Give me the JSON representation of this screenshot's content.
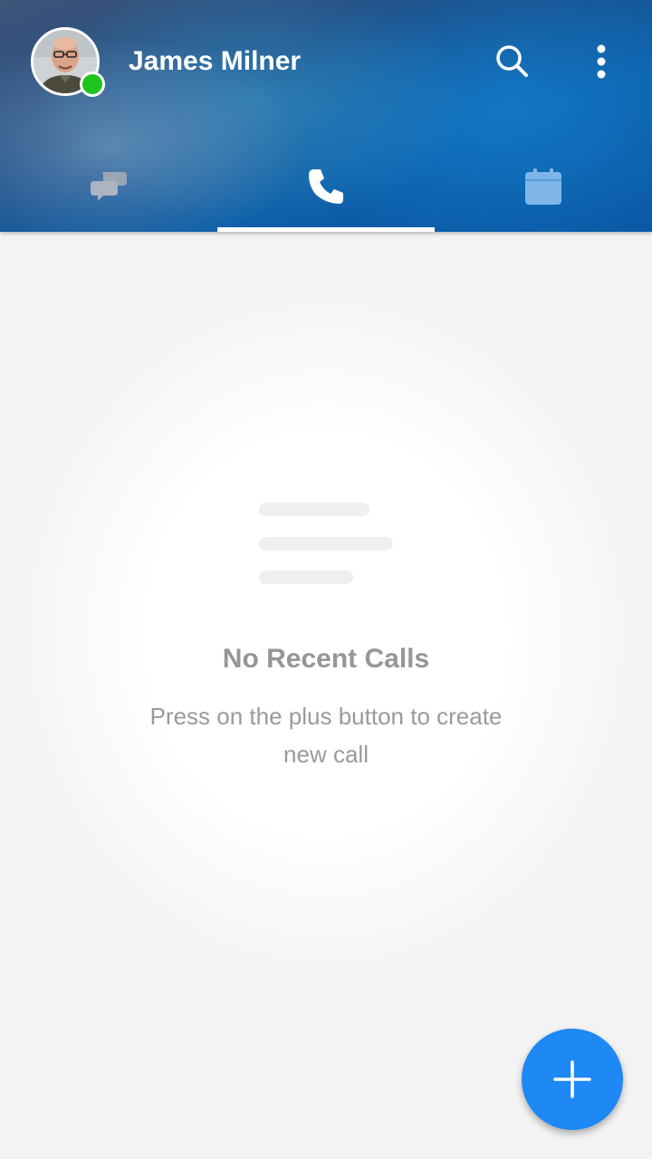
{
  "header": {
    "user_name": "James Milner",
    "status": "online",
    "status_color": "#1ec31e",
    "icons": {
      "search": "search-icon",
      "more": "more-vert-icon"
    }
  },
  "tabs": [
    {
      "name": "chats",
      "icon": "chat-bubbles-icon",
      "selected": false
    },
    {
      "name": "calls",
      "icon": "phone-icon",
      "selected": true
    },
    {
      "name": "calendar",
      "icon": "calendar-icon",
      "selected": false
    }
  ],
  "empty_state": {
    "title": "No Recent Calls",
    "subtitle": "Press on the plus button to create new call"
  },
  "fab": {
    "icon": "plus-icon",
    "color": "#1e88f5"
  },
  "colors": {
    "header_blue": "#0d5fa8",
    "accent": "#1e88f5",
    "background": "#f3f3f3"
  }
}
